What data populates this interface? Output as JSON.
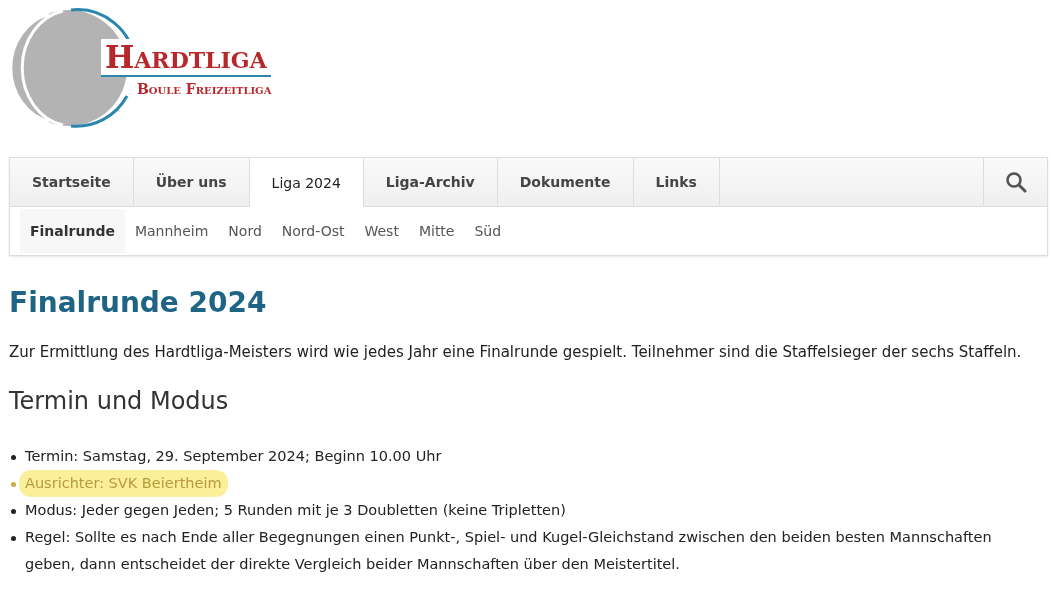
{
  "logo": {
    "title": "Hardtliga",
    "subtitle": "Boule Freizeitliga"
  },
  "nav": {
    "items": [
      {
        "label": "Startseite",
        "selected": false
      },
      {
        "label": "Über uns",
        "selected": false
      },
      {
        "label": "Liga 2024",
        "selected": true
      },
      {
        "label": "Liga-Archiv",
        "selected": false
      },
      {
        "label": "Dokumente",
        "selected": false
      },
      {
        "label": "Links",
        "selected": false
      }
    ],
    "subitems": [
      {
        "label": "Finalrunde",
        "selected": true
      },
      {
        "label": "Mannheim",
        "selected": false
      },
      {
        "label": "Nord",
        "selected": false
      },
      {
        "label": "Nord-Ost",
        "selected": false
      },
      {
        "label": "West",
        "selected": false
      },
      {
        "label": "Mitte",
        "selected": false
      },
      {
        "label": "Süd",
        "selected": false
      }
    ]
  },
  "heading": "Finalrunde 2024",
  "intro": "Zur Ermittlung des Hardtliga-Meisters wird wie jedes Jahr eine Finalrunde gespielt. Teilnehmer sind die Staffelsieger der sechs Staffeln.",
  "section_heading": "Termin und Modus",
  "list": [
    {
      "text": "Termin: Samstag, 29. September 2024; Beginn 10.00 Uhr",
      "highlighted": false
    },
    {
      "text": "Ausrichter: SVK Beiertheim",
      "highlighted": true
    },
    {
      "text": "Modus: Jeder gegen Jeden; 5 Runden mit je 3 Doubletten (keine Tripletten)",
      "highlighted": false
    },
    {
      "text": "Regel: Sollte es nach Ende aller Begegnungen einen Punkt-, Spiel- und Kugel-Gleichstand zwischen den beiden besten Mannschaften geben, dann entscheidet der direkte Vergleich beider Mannschaften über den Meistertitel.",
      "highlighted": false
    }
  ]
}
